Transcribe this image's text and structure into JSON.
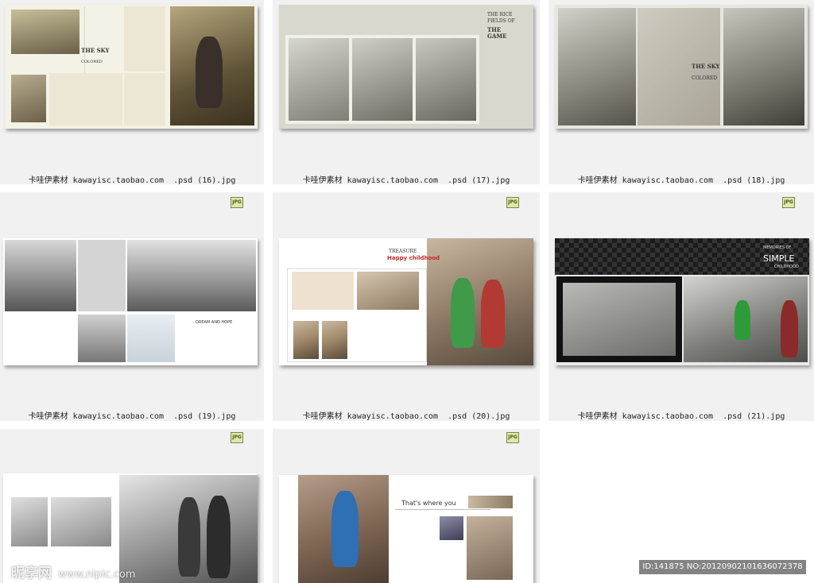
{
  "items": [
    {
      "caption": "卡哇伊素材 kawayisc.taobao.com  .psd (16).jpg",
      "badge": "",
      "texts": {
        "sky_title": "THE SKY",
        "sky_sub": "COLORED"
      }
    },
    {
      "caption": "卡哇伊素材 kawayisc.taobao.com  .psd (17).jpg",
      "badge": "",
      "texts": {
        "t1": "THE RICE",
        "t2": "FIELDS OF",
        "t3": "THE",
        "t4": "GAME"
      }
    },
    {
      "caption": "卡哇伊素材 kawayisc.taobao.com  .psd (18).jpg",
      "badge": "",
      "texts": {
        "sky_title": "THE SKY",
        "sky_sub": "COLORED"
      }
    },
    {
      "caption": "卡哇伊素材 kawayisc.taobao.com  .psd (19).jpg",
      "badge": "JPG",
      "texts": {
        "dream": "DREAM AND HOPE"
      }
    },
    {
      "caption": "卡哇伊素材 kawayisc.taobao.com  .psd (20).jpg",
      "badge": "JPG",
      "texts": {
        "treasure": "TREASURE",
        "happy": "Happy childhood"
      }
    },
    {
      "caption": "卡哇伊素材 kawayisc.taobao.com  .psd (21).jpg",
      "badge": "JPG",
      "texts": {
        "simple": "SIMPLE",
        "memories": "MEMORIES OF",
        "childhood": "CHILDHOOD"
      }
    },
    {
      "caption": "",
      "badge": "JPG",
      "texts": {}
    },
    {
      "caption": "",
      "badge": "JPG",
      "texts": {
        "where": "That's where you"
      }
    }
  ],
  "watermark": {
    "brand": "昵享网",
    "url": "www.nipic.com"
  },
  "id_info": "ID:141875 NO:20120902101636072378",
  "colors": {
    "cell_bg": "#f1f1f1",
    "accent_red": "#c62828",
    "accent_green": "#2e7d32"
  }
}
